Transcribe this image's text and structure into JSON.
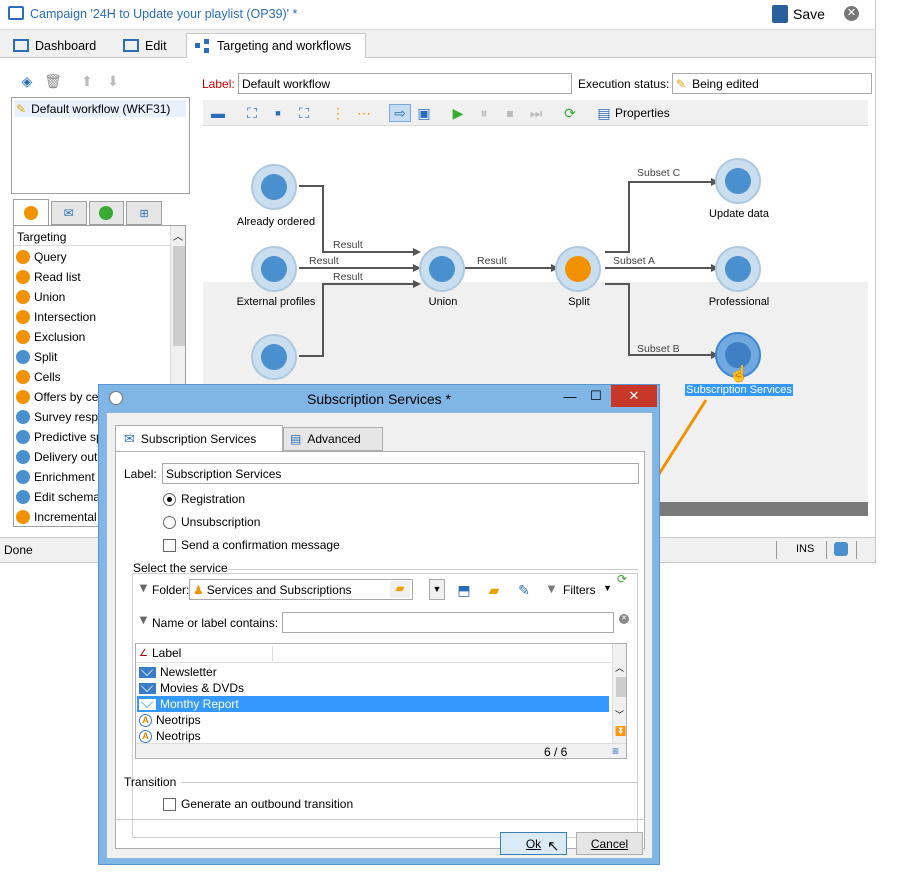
{
  "window": {
    "title": "Campaign '24H to Update your playlist (OP39)' *",
    "save_label": "Save"
  },
  "tabs": [
    {
      "label": "Dashboard"
    },
    {
      "label": "Edit"
    },
    {
      "label": "Targeting and workflows"
    }
  ],
  "workflow_list": {
    "items": [
      "Default workflow (WKF31)"
    ]
  },
  "header": {
    "label_caption": "Label:",
    "label_value": "Default workflow",
    "exec_caption": "Execution status:",
    "exec_value": "Being edited",
    "properties_label": "Properties"
  },
  "activities": {
    "group_title": "Targeting",
    "items": [
      "Query",
      "Read list",
      "Union",
      "Intersection",
      "Exclusion",
      "Split",
      "Cells",
      "Offers by ce",
      "Survey resp",
      "Predictive sp",
      "Delivery out",
      "Enrichment",
      "Edit schema",
      "Incremental"
    ]
  },
  "canvas": {
    "nodes": [
      {
        "label": "Already ordered"
      },
      {
        "label": "External profiles"
      },
      {
        "label": ""
      },
      {
        "label": "Union"
      },
      {
        "label": "Split"
      },
      {
        "label": "Update data"
      },
      {
        "label": "Professional"
      },
      {
        "label": "Subscription Services"
      }
    ],
    "edges": [
      "Result",
      "Result",
      "Result",
      "Result",
      "Subset C",
      "Subset A",
      "Subset B"
    ]
  },
  "status": {
    "left": "Done",
    "ins": "INS"
  },
  "dialog": {
    "title": "Subscription Services *",
    "tab_main": "Subscription Services",
    "tab_advanced": "Advanced",
    "label_caption": "Label:",
    "label_value": "Subscription Services",
    "registration": "Registration",
    "unsubscription": "Unsubscription",
    "send_confirmation": "Send a confirmation message",
    "select_service": "Select the service",
    "folder_caption": "Folder:",
    "folder_value": "Services and Subscriptions",
    "filters": "Filters",
    "name_contains": "Name or label contains:",
    "column_label": "Label",
    "rows": [
      {
        "label": "Newsletter",
        "icon": "mail-icon"
      },
      {
        "label": "Movies & DVDs",
        "icon": "mail-icon"
      },
      {
        "label": "Monthy Report",
        "icon": "mail-icon"
      },
      {
        "label": "Neotrips",
        "icon": "service-a-icon"
      },
      {
        "label": "Neotrips",
        "icon": "service-a-icon"
      }
    ],
    "count": "6 / 6",
    "transition_title": "Transition",
    "generate_transition": "Generate an outbound transition",
    "ok": "Ok",
    "cancel": "Cancel"
  },
  "colors": {
    "accent": "#3399ff",
    "node": "#4a8fce",
    "orange": "#f39200",
    "dialog_frame": "#7fb6e6"
  }
}
